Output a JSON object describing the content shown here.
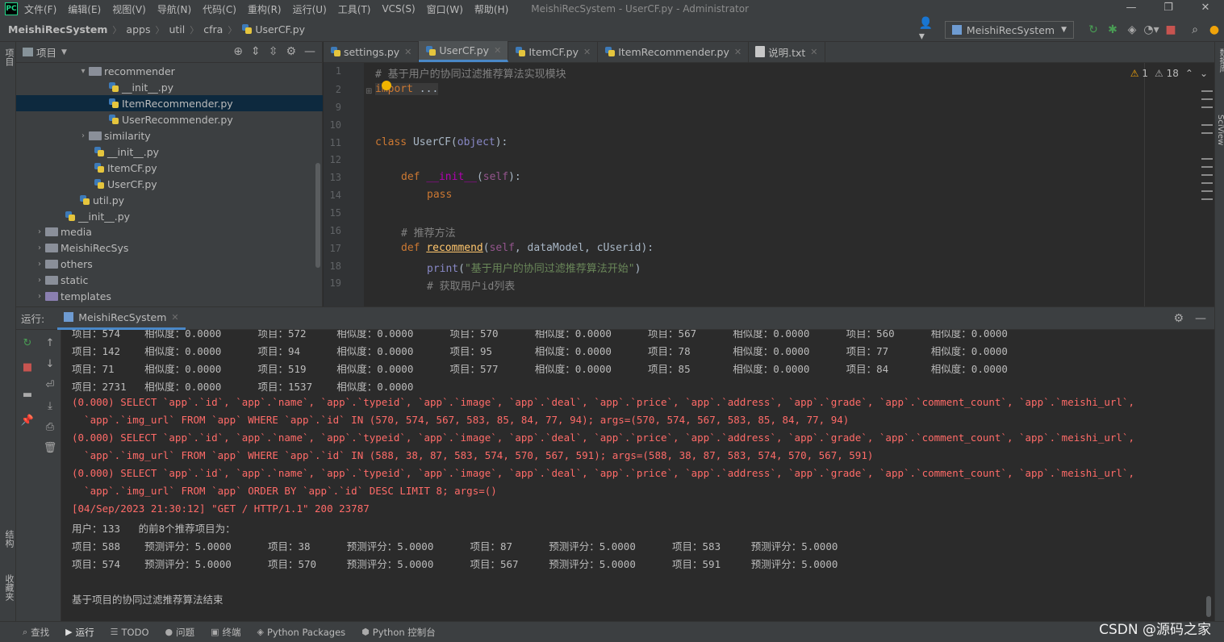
{
  "menu": {
    "items": [
      "文件(F)",
      "编辑(E)",
      "视图(V)",
      "导航(N)",
      "代码(C)",
      "重构(R)",
      "运行(U)",
      "工具(T)",
      "VCS(S)",
      "窗口(W)",
      "帮助(H)"
    ],
    "window_title": "MeishiRecSystem - UserCF.py - Administrator"
  },
  "breadcrumbs": [
    "MeishiRecSystem",
    "apps",
    "util",
    "cfra",
    "UserCF.py"
  ],
  "run_config": "MeishiRecSystem",
  "project_panel": {
    "title": "项目",
    "tree": [
      {
        "label": "recommender",
        "type": "folder",
        "arrow": "▾"
      },
      {
        "label": "__init__.py",
        "type": "py"
      },
      {
        "label": "ItemRecommender.py",
        "type": "py"
      },
      {
        "label": "UserRecommender.py",
        "type": "py"
      },
      {
        "label": "similarity",
        "type": "folder",
        "arrow": "›"
      },
      {
        "label": "__init__.py",
        "type": "py"
      },
      {
        "label": "ItemCF.py",
        "type": "py"
      },
      {
        "label": "UserCF.py",
        "type": "py"
      },
      {
        "label": "util.py",
        "type": "py"
      },
      {
        "label": "__init__.py",
        "type": "py"
      },
      {
        "label": "media",
        "type": "folder",
        "arrow": "›"
      },
      {
        "label": "MeishiRecSys",
        "type": "folder",
        "arrow": "›"
      },
      {
        "label": "others",
        "type": "folder",
        "arrow": "›"
      },
      {
        "label": "static",
        "type": "folder",
        "arrow": "›"
      },
      {
        "label": "templates",
        "type": "folder",
        "arrow": "›"
      }
    ]
  },
  "editor": {
    "tabs": [
      "settings.py",
      "UserCF.py",
      "ItemCF.py",
      "ItemRecommender.py",
      "说明.txt"
    ],
    "active_tab": "UserCF.py",
    "warnings": "1",
    "weak_warnings": "18",
    "line_numbers": [
      "1",
      "2",
      "9",
      "10",
      "11",
      "12",
      "13",
      "14",
      "15",
      "16",
      "17",
      "18",
      "19"
    ],
    "code": {
      "l1_comment": "# 基于用户的协同过滤推荐算法实现模块",
      "l2_import": "import",
      "l2_rest": " ...",
      "l11_class": "class",
      "l11_name": " UserCF(",
      "l11_base": "object",
      "l11_end": "):",
      "l13_def": "def",
      "l13_name": "__init__",
      "l13_open": "(",
      "l13_self": "self",
      "l13_end": "):",
      "l14_pass": "pass",
      "l16_comment": "# 推荐方法",
      "l17_def": "def",
      "l17_name": "recommend",
      "l17_open": "(",
      "l17_self": "self",
      "l17_args": ", dataModel, cUserid):",
      "l18_print": "print",
      "l18_open": "(",
      "l18_str": "\"基于用户的协同过滤推荐算法开始\"",
      "l18_end": ")",
      "l19_comment": "# 获取用户id列表"
    }
  },
  "run_panel": {
    "label": "运行:",
    "tab": "MeishiRecSystem",
    "lines": [
      {
        "text": "项目：574    相似度：0.0000      项目：572     相似度：0.0000      项目：570      相似度：0.0000      项目：567      相似度：0.0000      项目：560      相似度：0.0000",
        "err": false
      },
      {
        "text": "项目：142    相似度：0.0000      项目：94      相似度：0.0000      项目：95       相似度：0.0000      项目：78       相似度：0.0000      项目：77       相似度：0.0000",
        "err": false
      },
      {
        "text": "项目：71     相似度：0.0000      项目：519     相似度：0.0000      项目：577      相似度：0.0000      项目：85       相似度：0.0000      项目：84       相似度：0.0000",
        "err": false
      },
      {
        "text": "项目：2731   相似度：0.0000      项目：1537    相似度：0.0000",
        "err": false
      },
      {
        "text": "(0.000) SELECT `app`.`id`, `app`.`name`, `app`.`typeid`, `app`.`image`, `app`.`deal`, `app`.`price`, `app`.`address`, `app`.`grade`, `app`.`comment_count`, `app`.`meishi_url`,",
        "err": true
      },
      {
        "text": "  `app`.`img_url` FROM `app` WHERE `app`.`id` IN (570, 574, 567, 583, 85, 84, 77, 94); args=(570, 574, 567, 583, 85, 84, 77, 94)",
        "err": true
      },
      {
        "text": "(0.000) SELECT `app`.`id`, `app`.`name`, `app`.`typeid`, `app`.`image`, `app`.`deal`, `app`.`price`, `app`.`address`, `app`.`grade`, `app`.`comment_count`, `app`.`meishi_url`,",
        "err": true
      },
      {
        "text": "  `app`.`img_url` FROM `app` WHERE `app`.`id` IN (588, 38, 87, 583, 574, 570, 567, 591); args=(588, 38, 87, 583, 574, 570, 567, 591)",
        "err": true
      },
      {
        "text": "(0.000) SELECT `app`.`id`, `app`.`name`, `app`.`typeid`, `app`.`image`, `app`.`deal`, `app`.`price`, `app`.`address`, `app`.`grade`, `app`.`comment_count`, `app`.`meishi_url`,",
        "err": true
      },
      {
        "text": "  `app`.`img_url` FROM `app` ORDER BY `app`.`id` DESC LIMIT 8; args=()",
        "err": true
      },
      {
        "text": "[04/Sep/2023 21:30:12] \"GET / HTTP/1.1\" 200 23787",
        "err": true
      },
      {
        "text": "用户：133   的前8个推荐项目为：",
        "err": false
      },
      {
        "text": "项目：588    预测评分：5.0000      项目：38      预测评分：5.0000      项目：87      预测评分：5.0000      项目：583     预测评分：5.0000",
        "err": false
      },
      {
        "text": "项目：574    预测评分：5.0000      项目：570     预测评分：5.0000      项目：567     预测评分：5.0000      项目：591     预测评分：5.0000",
        "err": false
      },
      {
        "text": "",
        "err": false
      },
      {
        "text": "基于项目的协同过滤推荐算法结束",
        "err": false
      }
    ]
  },
  "left_stripe": {
    "top": "项目",
    "mid": "结构",
    "bottom": "收藏夹"
  },
  "right_stripe": {
    "top": "数据库",
    "mid": "SciView"
  },
  "status_bar": [
    "查找",
    "运行",
    "TODO",
    "问题",
    "终端",
    "Python Packages",
    "Python 控制台"
  ],
  "status_bar_active": "运行",
  "watermark": "CSDN @源码之家",
  "colors": {
    "accent": "#4a88c7",
    "error": "#ff6b68",
    "keyword": "#cc7832",
    "string": "#6a8759",
    "function": "#ffc66d"
  }
}
